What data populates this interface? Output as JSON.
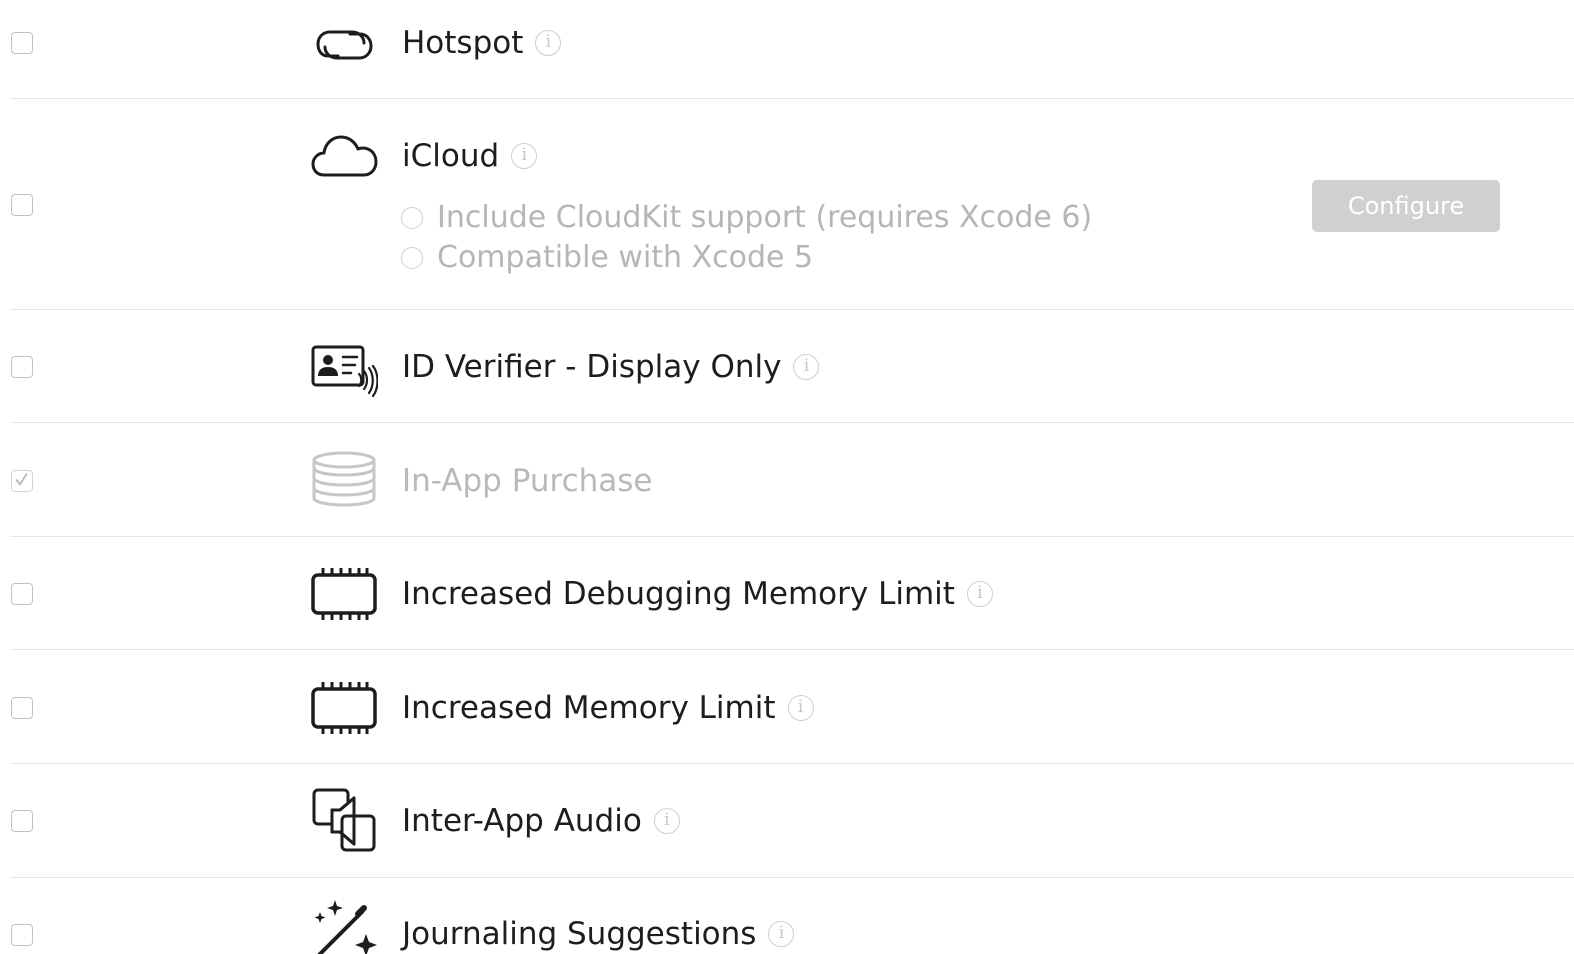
{
  "capabilities": [
    {
      "name": "Hotspot",
      "checked": false,
      "disabled": false,
      "icon": "hotspot-icon"
    },
    {
      "name": "iCloud",
      "checked": false,
      "disabled": false,
      "icon": "cloud-icon",
      "options": [
        "Include CloudKit support (requires Xcode 6)",
        "Compatible with Xcode 5"
      ],
      "configure_label": "Configure"
    },
    {
      "name": "ID Verifier - Display Only",
      "checked": false,
      "disabled": false,
      "icon": "id-card-icon"
    },
    {
      "name": "In-App Purchase",
      "checked": true,
      "disabled": true,
      "icon": "coins-icon"
    },
    {
      "name": "Increased Debugging Memory Limit",
      "checked": false,
      "disabled": false,
      "icon": "memory-chip-icon"
    },
    {
      "name": "Increased Memory Limit",
      "checked": false,
      "disabled": false,
      "icon": "memory-chip-icon"
    },
    {
      "name": "Inter-App Audio",
      "checked": false,
      "disabled": false,
      "icon": "inter-app-audio-icon"
    },
    {
      "name": "Journaling Suggestions",
      "checked": false,
      "disabled": false,
      "icon": "magic-wand-icon"
    }
  ],
  "info_glyph": "i",
  "colors": {
    "text": "#1d1d1f",
    "disabled_text": "#b9b9b9",
    "separator": "#e6e6e6",
    "button_disabled_bg": "#d0d0d0"
  }
}
